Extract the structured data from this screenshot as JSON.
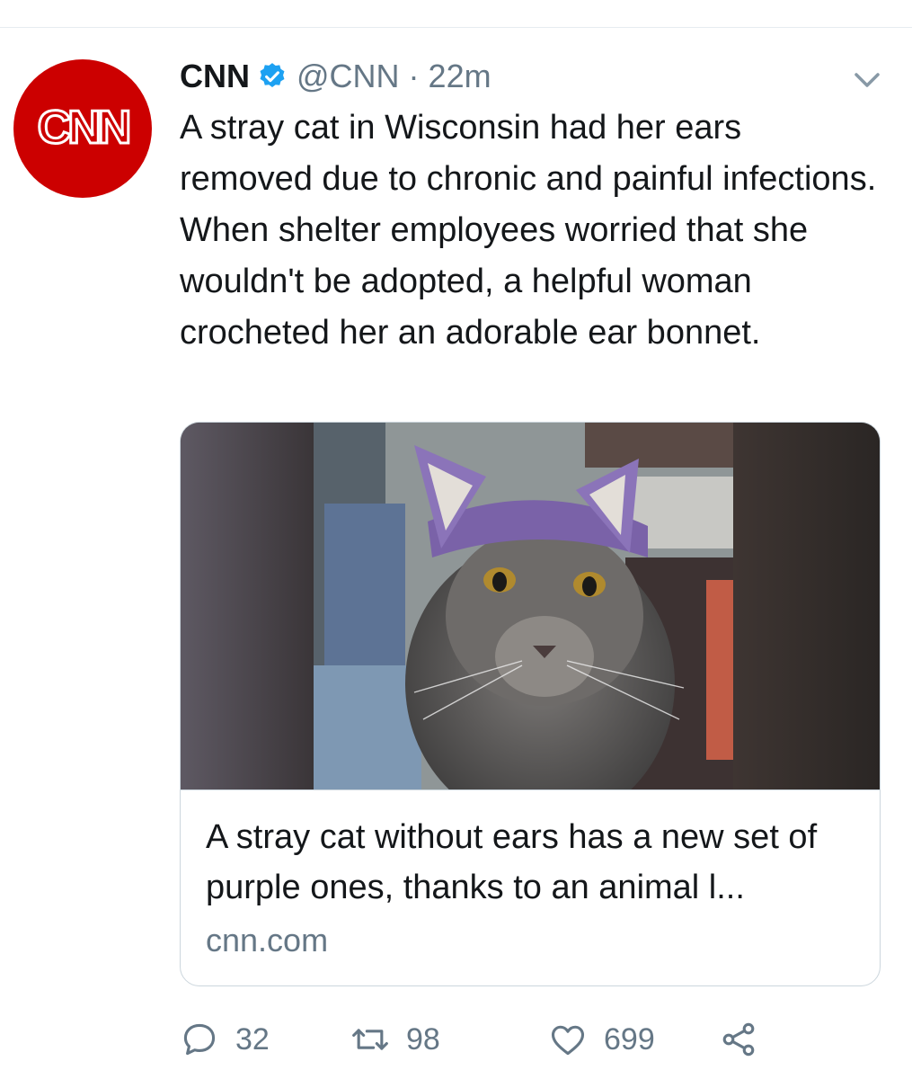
{
  "author": {
    "name": "CNN",
    "handle": "@CNN",
    "separator": "·",
    "time": "22m",
    "avatar_text": "CNN",
    "avatar_color": "#cc0000"
  },
  "tweet": {
    "text": "A stray cat in Wisconsin had her ears removed due to chronic and painful infections. When shelter employees worried that she wouldn't be adopted, a helpful woman crocheted her an adorable ear bonnet."
  },
  "card": {
    "title": "A stray cat without ears has a new set of purple ones, thanks to an animal l...",
    "domain": "cnn.com"
  },
  "actions": {
    "replies": "32",
    "retweets": "98",
    "likes": "699"
  },
  "icons": {
    "verified": "verified-badge-icon",
    "caret": "chevron-down-icon",
    "reply": "reply-icon",
    "retweet": "retweet-icon",
    "like": "heart-icon",
    "share": "share-icon"
  },
  "colors": {
    "verified_blue": "#1da1f2",
    "secondary_text": "#657786",
    "border": "#ccd6dd"
  }
}
